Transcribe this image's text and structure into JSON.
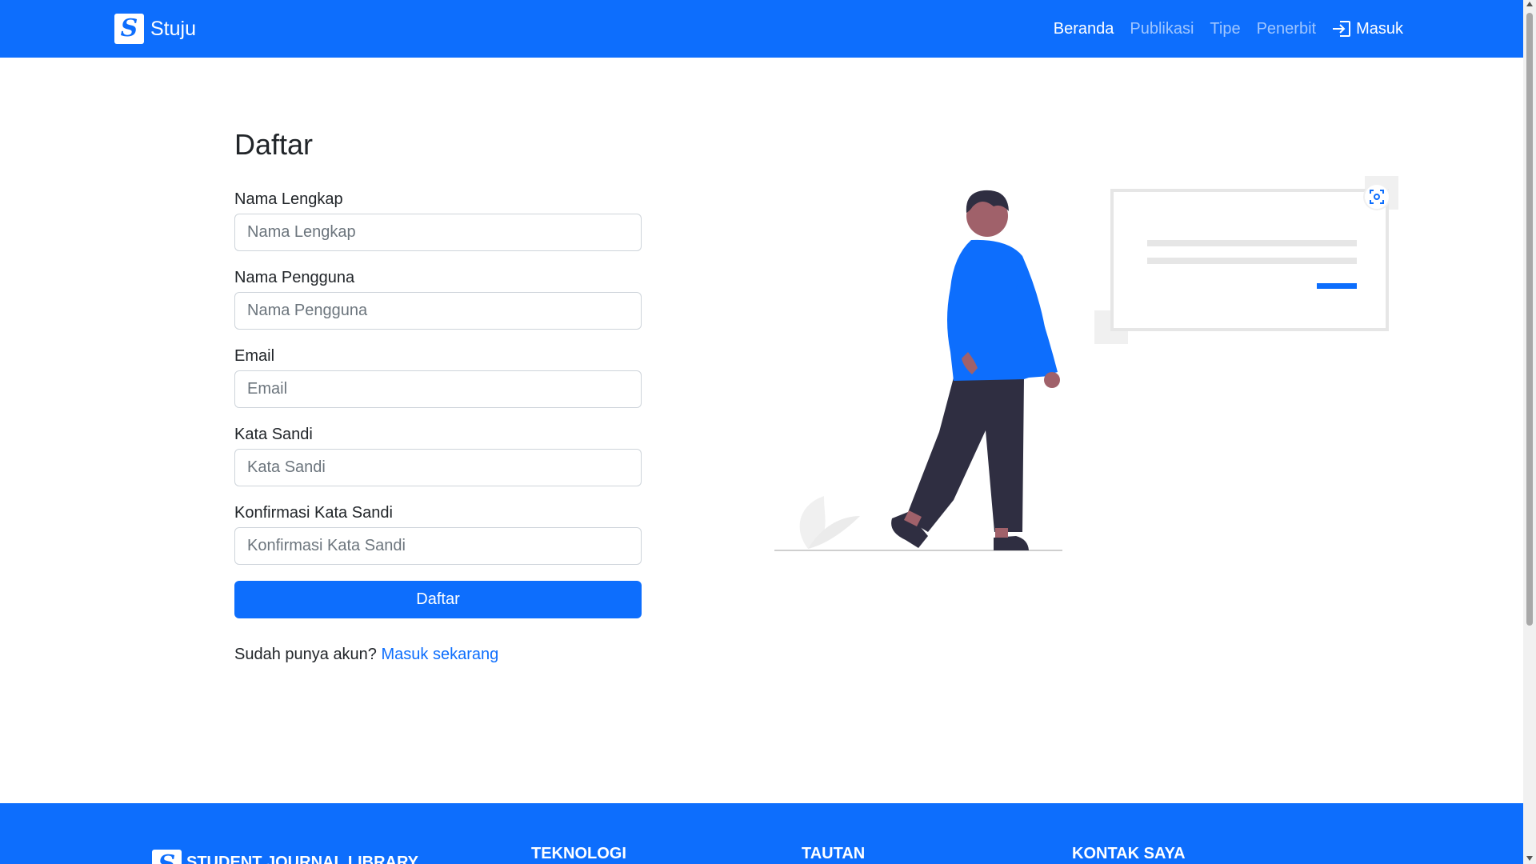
{
  "navbar": {
    "brand_icon_letter": "S",
    "brand_name": "Stuju",
    "links": [
      "Beranda",
      "Publikasi",
      "Tipe",
      "Penerbit"
    ],
    "login_label": "Masuk",
    "background_color": "#0d6efd"
  },
  "form": {
    "title": "Daftar",
    "fields": [
      {
        "label": "Nama Lengkap",
        "placeholder": "Nama Lengkap",
        "value": ""
      },
      {
        "label": "Nama Pengguna",
        "placeholder": "Nama Pengguna",
        "value": ""
      },
      {
        "label": "Email",
        "placeholder": "Email",
        "value": ""
      },
      {
        "label": "Kata Sandi",
        "placeholder": "Kata Sandi",
        "value": ""
      },
      {
        "label": "Konfirmasi Kata Sandi",
        "placeholder": "Konfirmasi Kata Sandi",
        "value": ""
      }
    ],
    "submit_label": "Daftar",
    "login_prompt": "Sudah punya akun?",
    "login_link": "Masuk sekarang"
  },
  "illustration": {
    "name": "person-walking-illustration",
    "accent_color": "#0d6efd"
  },
  "footer": {
    "brand_icon_letter": "S",
    "columns": [
      "STUDENT JOURNAL LIBRARY",
      "TEKNOLOGI",
      "TAUTAN",
      "KONTAK SAYA"
    ]
  }
}
